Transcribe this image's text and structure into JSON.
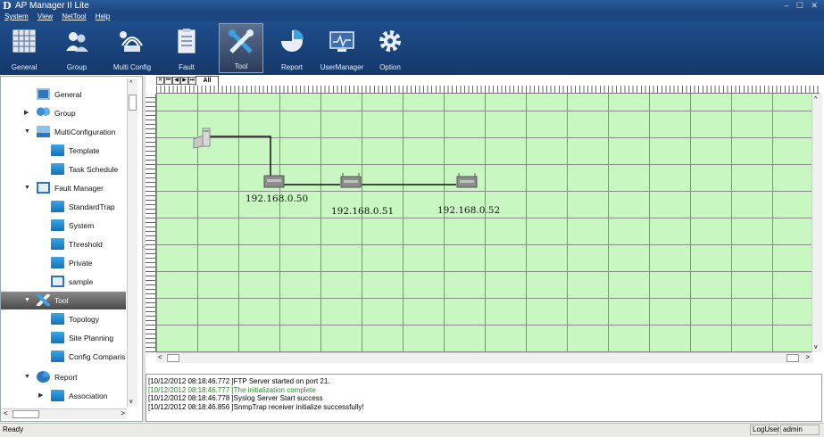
{
  "window": {
    "title": "AP Manager II Lite",
    "logo": "D",
    "controls": "– ☐ ✕"
  },
  "menu": [
    "System",
    "View",
    "NetTool",
    "Help"
  ],
  "toolbar": [
    {
      "label": "General",
      "icon": "general-grid-icon"
    },
    {
      "label": "Group",
      "icon": "group-users-icon"
    },
    {
      "label": "Multi Config",
      "icon": "multi-config-icon"
    },
    {
      "label": "Fault",
      "icon": "fault-clipboard-icon"
    },
    {
      "label": "Tool",
      "icon": "tool-wrench-icon"
    },
    {
      "label": "Report",
      "icon": "report-pie-icon"
    },
    {
      "label": "UserManager",
      "icon": "user-manager-icon"
    },
    {
      "label": "Option",
      "icon": "option-gear-icon"
    }
  ],
  "sidebar": {
    "items": [
      {
        "label": "General",
        "level": 0
      },
      {
        "label": "Group",
        "level": 0
      },
      {
        "label": "MultiConfiguration",
        "level": 0
      },
      {
        "label": "Template",
        "level": 1
      },
      {
        "label": "Task Schedule",
        "level": 1
      },
      {
        "label": "Fault Manager",
        "level": 0
      },
      {
        "label": "StandardTrap",
        "level": 1
      },
      {
        "label": "System",
        "level": 1
      },
      {
        "label": "Threshold",
        "level": 1
      },
      {
        "label": "Private",
        "level": 1
      },
      {
        "label": "sample",
        "level": 1
      },
      {
        "label": "Tool",
        "level": 0,
        "selected": true
      },
      {
        "label": "Topology",
        "level": 1
      },
      {
        "label": "Site Planning",
        "level": 1
      },
      {
        "label": "Config Comparis",
        "level": 1
      },
      {
        "label": "Report",
        "level": 0
      },
      {
        "label": "Association",
        "level": 1
      }
    ]
  },
  "tabs": {
    "nav": [
      "✕",
      "⏮",
      "◀",
      "▶",
      "⏭"
    ],
    "active": "All"
  },
  "topology": {
    "devices": [
      {
        "ip": "192.168.0.50"
      },
      {
        "ip": "192.168.0.51"
      },
      {
        "ip": "192.168.0.52"
      }
    ]
  },
  "log": [
    {
      "text": "[10/12/2012 08:18:46.772 ]FTP Server started on port 21.",
      "color": "#000000"
    },
    {
      "text": "[10/12/2012 08:18:46.777 ]The initialization complete",
      "color": "#2a8a2a"
    },
    {
      "text": "[10/12/2012 08:18:46.778 ]Syslog Server Start success",
      "color": "#000000"
    },
    {
      "text": "[10/12/2012 08:18:46.856 ]SnmpTrap receiver initialize successfully!",
      "color": "#000000"
    }
  ],
  "status": {
    "left": "Ready",
    "role": "LogUser",
    "user": "admin"
  },
  "colors": {
    "accent": "#1d4680",
    "canvas": "#c9f7c2",
    "log_green": "#2a8a2a"
  }
}
